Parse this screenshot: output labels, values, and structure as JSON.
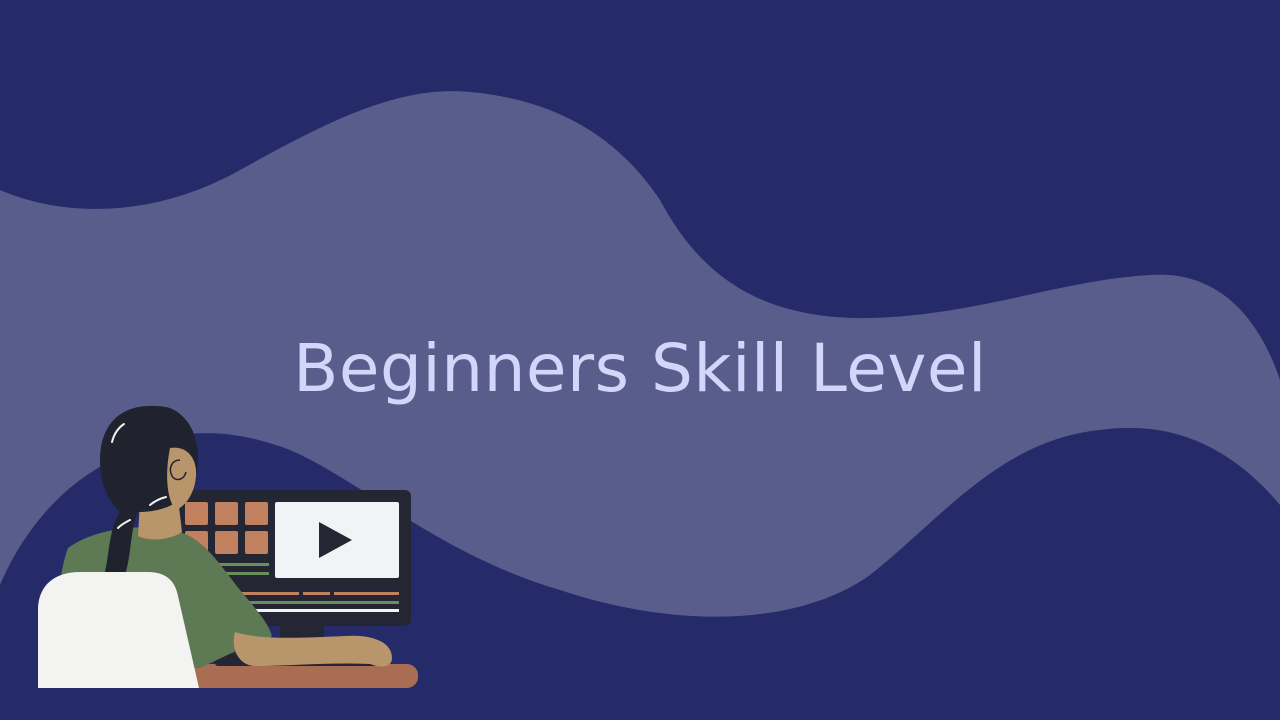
{
  "slide": {
    "title": "Beginners Skill Level"
  },
  "colors": {
    "background": "#252a69",
    "wave": "#585d8b",
    "title": "#d3d6fb",
    "monitor": "#242634",
    "screen": "#f2f3f4",
    "tiles": "#c1805e",
    "timeline_green": "#6a8f5c",
    "shirt": "#5d7a55",
    "skin": "#b8956a",
    "hair": "#20222e",
    "chair": "#f3f4f2",
    "desk": "#a86d52"
  },
  "illustration": {
    "name": "person-editing-video",
    "monitor_icon": "play-icon"
  }
}
